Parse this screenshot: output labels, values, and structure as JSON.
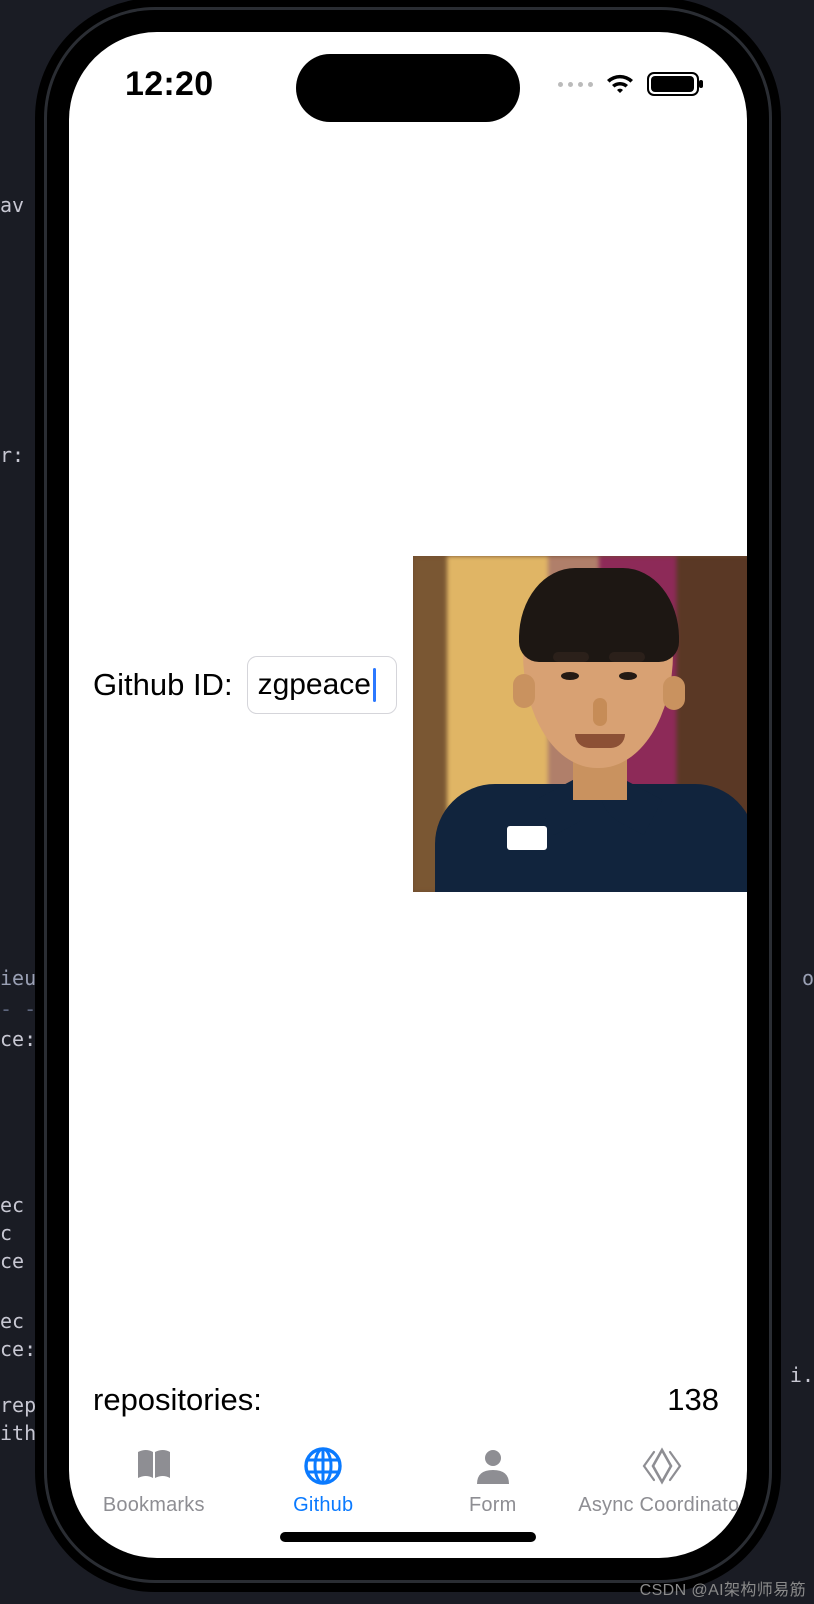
{
  "status": {
    "time": "12:20"
  },
  "main": {
    "github_id_label": "Github ID:",
    "github_id_value": "zgpeace",
    "repositories_label": "repositories:",
    "repositories_count": "138"
  },
  "tabs": [
    {
      "label": "Bookmarks"
    },
    {
      "label": "Github"
    },
    {
      "label": "Form"
    },
    {
      "label": "Async Coordinator"
    }
  ],
  "watermark": "CSDN @AI架构师易筋",
  "bg": {
    "l1": "av",
    "l2": "r:",
    "l3": "ieue",
    "l4": "- -",
    "l5": "ce:",
    "l6": "ec",
    "l7": "c",
    "l8": "ce",
    "l9": "ec",
    "l10": "ce:",
    "l11": "rep",
    "l12": "ith",
    "r1": "o",
    "r2": "i."
  }
}
